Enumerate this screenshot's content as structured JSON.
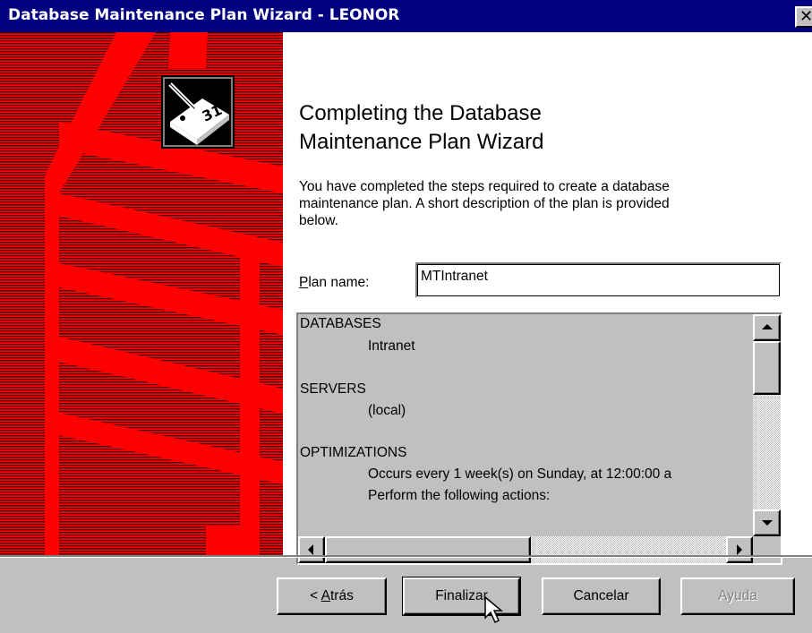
{
  "window": {
    "title": "Database Maintenance Plan Wizard - LEONOR",
    "close_glyph": "✕"
  },
  "heading": {
    "line1": "Completing the Database",
    "line2": "Maintenance Plan Wizard"
  },
  "description": {
    "line1": "You have completed the steps required to create a database",
    "line2": "maintenance plan. A short description of the plan is provided",
    "line3": "below."
  },
  "plan_name": {
    "label_accel": "P",
    "label_rest": "lan name:",
    "value": "MTIntranet"
  },
  "summary": {
    "lines": [
      "DATABASES",
      "Intranet",
      "SERVERS",
      "(local)",
      "OPTIMIZATIONS",
      "Occurs every 1 week(s) on Sunday, at 12:00:00 a",
      "Perform the following actions:"
    ]
  },
  "buttons": {
    "back_prefix": "< ",
    "back_accel": "A",
    "back_rest": "trás",
    "finish": "Finalizar",
    "cancel": "Cancelar",
    "help": "Ayuda"
  },
  "icons": {
    "wizard": "notepad-pencil-icon",
    "cursor": "mouse-pointer-icon"
  },
  "colors": {
    "titlebar": "#000080",
    "sidebar_red": "#ff0000",
    "sidebar_dark": "#800000",
    "face": "#c0c0c0"
  }
}
